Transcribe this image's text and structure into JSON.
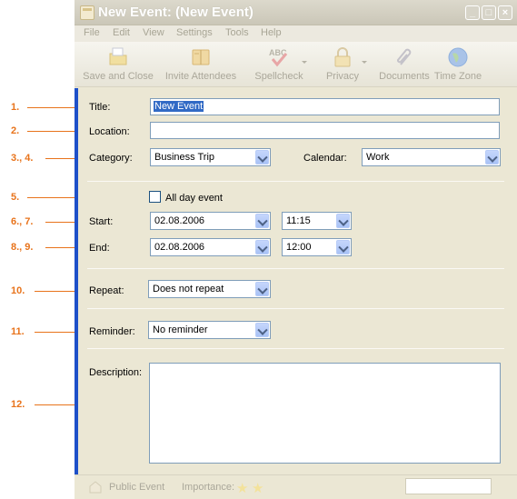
{
  "window": {
    "title": "New Event: (New Event)",
    "controls": [
      "_",
      "□",
      "×"
    ]
  },
  "menu": [
    "File",
    "Edit",
    "View",
    "Settings",
    "Tools",
    "Help"
  ],
  "toolbar": {
    "save_close": "Save and Close",
    "invite": "Invite Attendees",
    "spellcheck": "Spellcheck",
    "spellcheck_abc": "ABC",
    "privacy": "Privacy",
    "documents": "Documents",
    "timezone": "Time Zone"
  },
  "annotations": [
    "1.",
    "2.",
    "3., 4.",
    "5.",
    "6., 7.",
    "8., 9.",
    "10.",
    "11.",
    "12."
  ],
  "form": {
    "title_label": "Title:",
    "title_value": "New Event",
    "location_label": "Location:",
    "location_value": "",
    "category_label": "Category:",
    "category_value": "Business Trip",
    "calendar_label": "Calendar:",
    "calendar_value": "Work",
    "allday_label": "All day event",
    "start_label": "Start:",
    "start_date": "02.08.2006",
    "start_time": "11:15",
    "end_label": "End:",
    "end_date": "02.08.2006",
    "end_time": "12:00",
    "repeat_label": "Repeat:",
    "repeat_value": "Does not repeat",
    "reminder_label": "Reminder:",
    "reminder_value": "No reminder",
    "description_label": "Description:"
  },
  "status": {
    "public_event": "Public Event",
    "importance": "Importance:",
    "stars": [
      "★",
      "★"
    ]
  },
  "colors": {
    "annotation": "#e8731b",
    "accent_border": "#1e50c8"
  }
}
